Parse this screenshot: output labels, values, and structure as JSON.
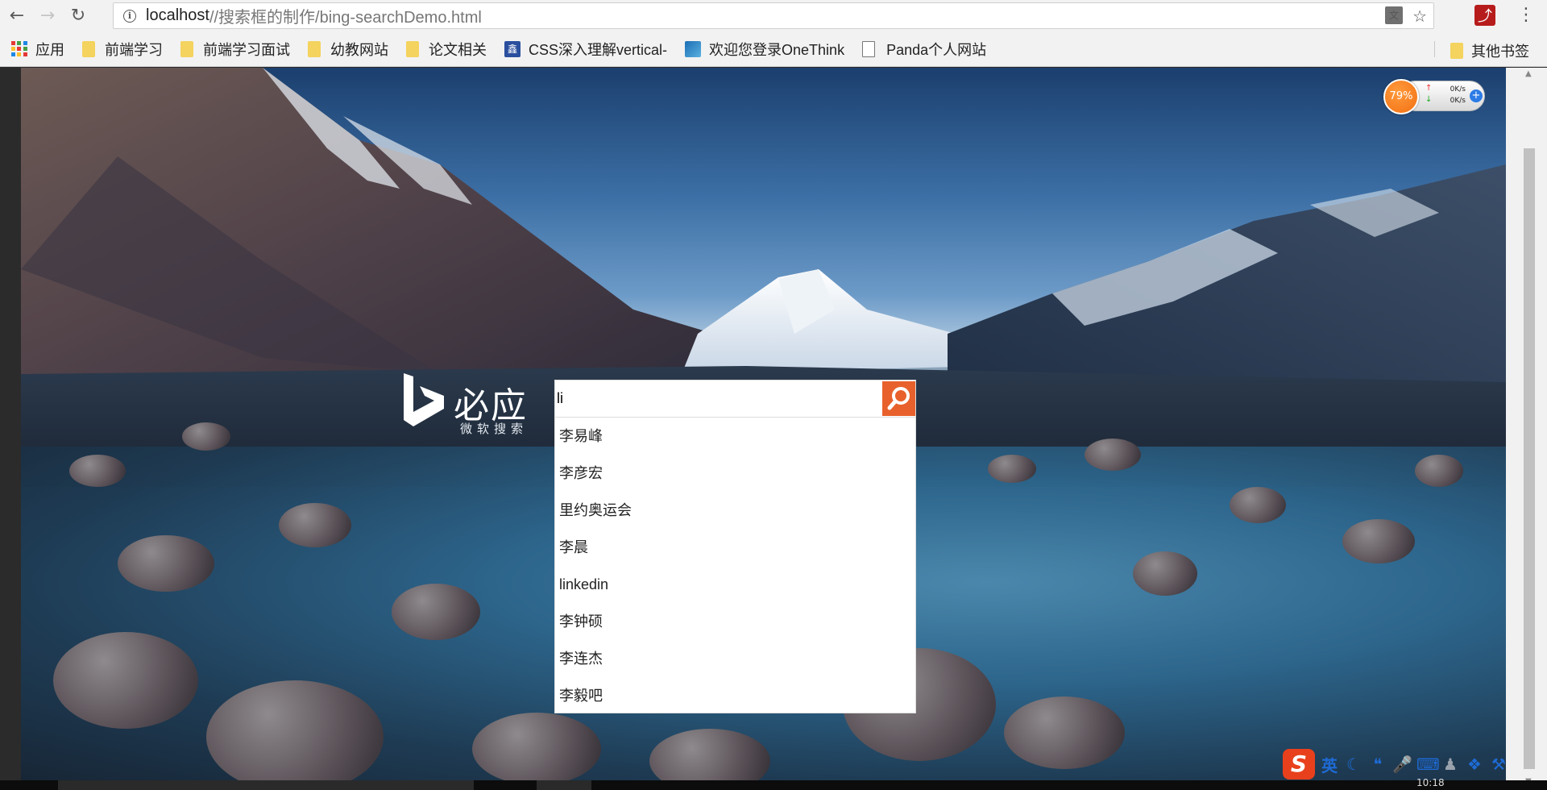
{
  "browser": {
    "url_host": "localhost",
    "url_path": "//搜索框的制作/bing-searchDemo.html",
    "bookmarks": [
      {
        "label": "应用",
        "kind": "apps"
      },
      {
        "label": "前端学习",
        "kind": "folder"
      },
      {
        "label": "前端学习面试",
        "kind": "folder"
      },
      {
        "label": "幼教网站",
        "kind": "folder"
      },
      {
        "label": "论文相关",
        "kind": "folder"
      },
      {
        "label": "CSS深入理解vertical-",
        "kind": "site"
      },
      {
        "label": "欢迎您登录OneThink",
        "kind": "site"
      },
      {
        "label": "Panda个人网站",
        "kind": "page"
      }
    ],
    "other_bookmarks": "其他书签"
  },
  "page": {
    "logo": {
      "brand": "必应",
      "subtitle": "微软搜索"
    },
    "search": {
      "value": "li"
    },
    "suggestions": [
      "李易峰",
      "李彦宏",
      "里约奥运会",
      "李晨",
      "linkedin",
      "李钟硕",
      "李连杰",
      "李毅吧"
    ]
  },
  "widgets": {
    "speed": {
      "percent": "79%",
      "up": "0K/s",
      "down": "0K/s"
    },
    "ime": {
      "mode": "英"
    },
    "clock": "10:18"
  },
  "colors": {
    "search_button": "#e8612c",
    "speed_ring": "#f27012"
  }
}
